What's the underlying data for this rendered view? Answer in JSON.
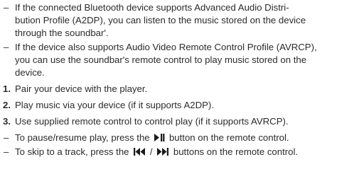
{
  "bullets_top": [
    {
      "marker": "–",
      "lines": [
        "If the connected Bluetooth device supports Advanced Audio Distri-",
        "bution Profile (A2DP), you can listen to the music stored on the device",
        "through the soundbar'."
      ]
    },
    {
      "marker": "–",
      "lines": [
        "If the device also supports Audio Video Remote Control Profile (AVRCP),",
        "you can use the soundbar's remote control to play music stored on the",
        "device."
      ]
    }
  ],
  "steps": [
    {
      "marker": "1.",
      "text": "Pair your device with the player."
    },
    {
      "marker": "2.",
      "text": "Play music via your device (if it supports A2DP)."
    },
    {
      "marker": "3.",
      "text": "Use supplied remote control to control play (if it supports AVRCP)."
    }
  ],
  "notes": [
    {
      "marker": "–",
      "before": "To pause/resume play, press the",
      "icon": "play-pause-icon",
      "after": "button on the remote control."
    },
    {
      "marker": "–",
      "before": "To skip to a track, press the",
      "icon": "skip-previous-next-icons",
      "separator": "/",
      "after": "buttons on the remote control."
    }
  ]
}
